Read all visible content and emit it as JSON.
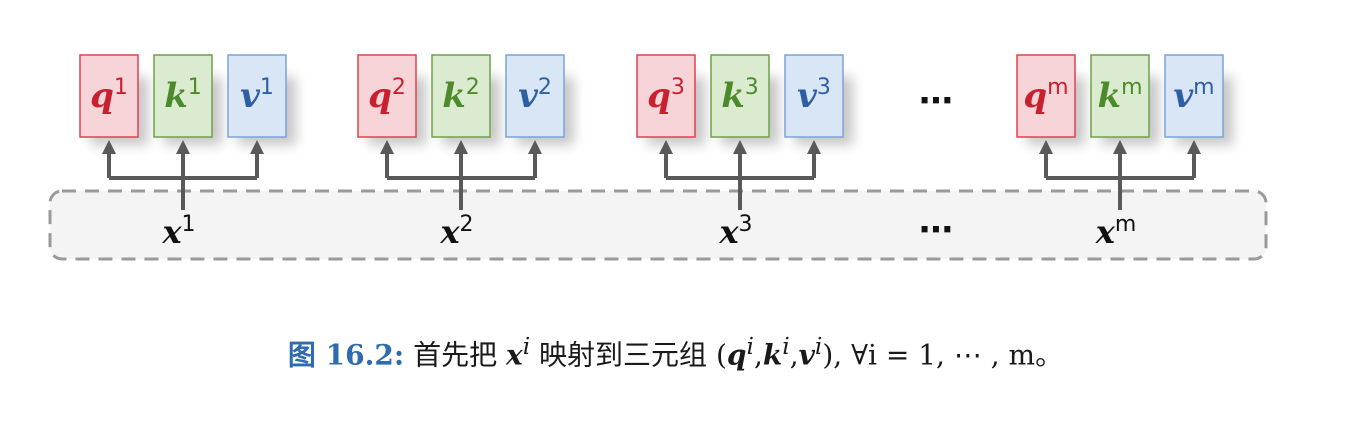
{
  "colors": {
    "q_fill": "#f7d4d8",
    "q_stroke": "#e0434f",
    "q_text": "#c8202f",
    "k_fill": "#dbebcf",
    "k_stroke": "#6fa14a",
    "k_text": "#4d8a2c",
    "v_fill": "#d9e6f5",
    "v_stroke": "#7aa3d6",
    "v_text": "#2e5fa3",
    "arrow": "#595959",
    "dashed_border": "#9a9a9a",
    "band_fill": "#f4f4f4",
    "caption_label": "#2e6bb0"
  },
  "groups": [
    {
      "q": "q",
      "k": "k",
      "v": "v",
      "sup": "1",
      "x": "x"
    },
    {
      "q": "q",
      "k": "k",
      "v": "v",
      "sup": "2",
      "x": "x"
    },
    {
      "q": "q",
      "k": "k",
      "v": "v",
      "sup": "3",
      "x": "x"
    },
    {
      "q": "q",
      "k": "k",
      "v": "v",
      "sup": "m",
      "x": "x"
    }
  ],
  "ellipsis": "⋯",
  "caption": {
    "label": "图 16.2:",
    "text_before": " 首先把 ",
    "x": "x",
    "sup_i": "i",
    "text_mid": " 映射到三元组 (",
    "q": "q",
    "comma": ",",
    "k": "k",
    "v": "v",
    "text_after": "),  ∀i = 1, ⋯ , m。"
  }
}
